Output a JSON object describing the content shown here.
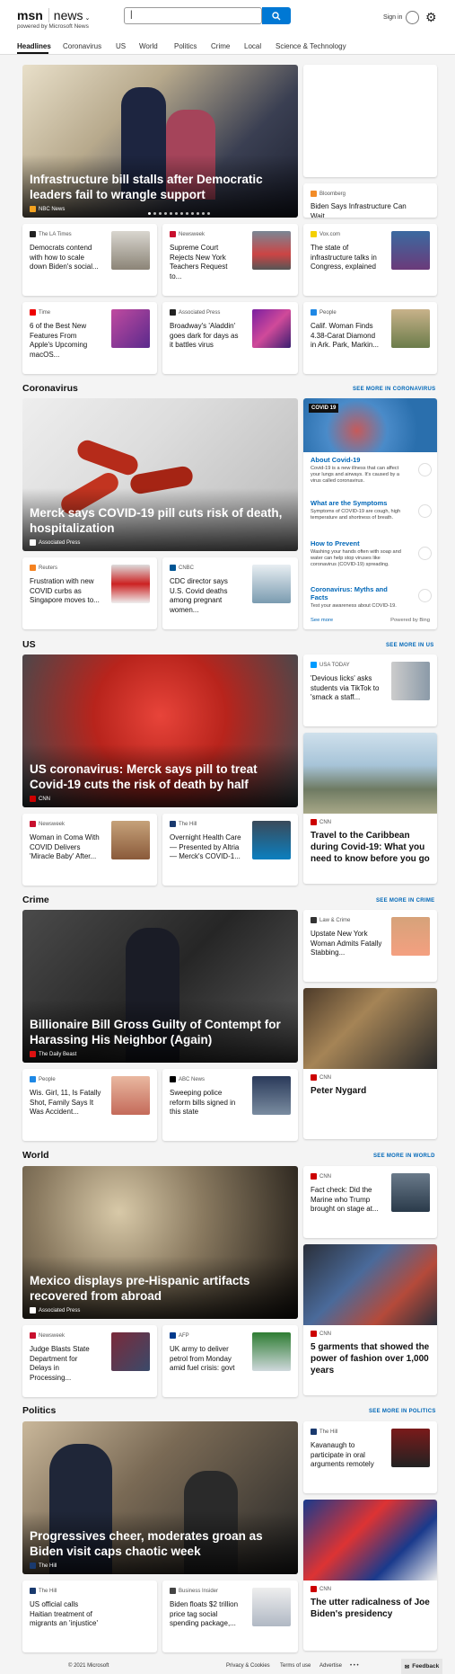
{
  "header": {
    "logo_msn": "msn",
    "logo_news": "news",
    "powered": "powered by Microsoft News",
    "search_value": "|",
    "signin": "Sign in"
  },
  "nav": [
    "Headlines",
    "Coronavirus",
    "US",
    "World",
    "Politics",
    "Crime",
    "Local",
    "Science & Technology"
  ],
  "top": {
    "hero": {
      "title": "Infrastructure bill stalls after Democratic leaders fail to wrangle support",
      "source": "NBC News"
    },
    "side_caption": {
      "source": "Bloomberg",
      "title": "Biden Says Infrastructure Can Wait,..."
    },
    "row1": [
      {
        "source": "The LA Times",
        "title": "Democrats contend with how to scale down Biden's social..."
      },
      {
        "source": "Newsweek",
        "title": "Supreme Court Rejects New York Teachers Request to..."
      },
      {
        "source": "Vox.com",
        "title": "The state of infrastructure talks in Congress, explained"
      }
    ],
    "row2": [
      {
        "source": "Time",
        "title": "6 of the Best New Features From Apple's Upcoming macOS..."
      },
      {
        "source": "Associated Press",
        "title": "Broadway's 'Aladdin' goes dark for days as it battles virus"
      },
      {
        "source": "People",
        "title": "Calif. Woman Finds 4.38-Carat Diamond in Ark. Park, Markin..."
      }
    ]
  },
  "coronavirus": {
    "heading": "Coronavirus",
    "more": "SEE MORE IN CORONAVIRUS",
    "hero": {
      "title": "Merck says COVID-19 pill cuts risk of death, hospitalization",
      "source": "Associated Press"
    },
    "panel": {
      "tag": "COVID 19",
      "items": [
        {
          "h": "About Covid-19",
          "d": "Covid-19 is a new illness that can affect your lungs and airways. It's caused by a virus called coronavirus."
        },
        {
          "h": "What are the Symptoms",
          "d": "Symptoms of COVID-19 are cough, high temperature and shortness of breath."
        },
        {
          "h": "How to Prevent",
          "d": "Washing your hands often with soap and water can help stop viruses like coronavirus (COVID-19) spreading."
        },
        {
          "h": "Coronavirus: Myths and Facts",
          "d": "Test your awareness about COVID-19."
        }
      ],
      "see_more": "See more",
      "powered": "Powered by Bing"
    },
    "row": [
      {
        "source": "Reuters",
        "title": "Frustration with new COVID curbs as Singapore moves to..."
      },
      {
        "source": "CNBC",
        "title": "CDC director says U.S. Covid deaths among pregnant women..."
      }
    ]
  },
  "us": {
    "heading": "US",
    "more": "SEE MORE IN US",
    "hero": {
      "title": "US coronavirus: Merck says pill to treat Covid-19 cuts the risk of death by half",
      "source": "CNN"
    },
    "side": {
      "source": "USA TODAY",
      "title": "'Devious licks' asks students via TikTok to 'smack a staff..."
    },
    "tall": {
      "source": "CNN",
      "title": "Travel to the Caribbean during Covid-19: What you need to know before you go"
    },
    "row": [
      {
        "source": "Newsweek",
        "title": "Woman in Coma With COVID Delivers 'Miracle Baby' After..."
      },
      {
        "source": "The Hill",
        "title": "Overnight Health Care — Presented by Altria — Merck's COVID-1..."
      }
    ]
  },
  "crime": {
    "heading": "Crime",
    "more": "SEE MORE IN CRIME",
    "hero": {
      "title": "Billionaire Bill Gross Guilty of Contempt for Harassing His Neighbor (Again)",
      "source": "The Daily Beast"
    },
    "side": {
      "source": "Law & Crime",
      "title": "Upstate New York Woman Admits Fatally Stabbing..."
    },
    "tall": {
      "source": "CNN",
      "title": "Peter Nygard"
    },
    "row": [
      {
        "source": "People",
        "title": "Wis. Girl, 11, Is Fatally Shot, Family Says It Was Accident..."
      },
      {
        "source": "ABC News",
        "title": "Sweeping police reform bills signed in this state"
      }
    ]
  },
  "world": {
    "heading": "World",
    "more": "SEE MORE IN WORLD",
    "hero": {
      "title": "Mexico displays pre-Hispanic artifacts recovered from abroad",
      "source": "Associated Press"
    },
    "side": {
      "source": "CNN",
      "title": "Fact check: Did the Marine who Trump brought on stage at..."
    },
    "tall": {
      "source": "CNN",
      "title": "5 garments that showed the power of fashion over 1,000 years"
    },
    "row": [
      {
        "source": "Newsweek",
        "title": "Judge Blasts State Department for Delays in Processing..."
      },
      {
        "source": "AFP",
        "title": "UK army to deliver petrol from Monday amid fuel crisis: govt"
      }
    ]
  },
  "politics": {
    "heading": "Politics",
    "more": "SEE MORE IN POLITICS",
    "hero": {
      "title": "Progressives cheer, moderates groan as Biden visit caps chaotic week",
      "source": "The Hill"
    },
    "side": {
      "source": "The Hill",
      "title": "Kavanaugh to participate in oral arguments remotely"
    },
    "tall": {
      "source": "CNN",
      "title": "The utter radicalness of Joe Biden's presidency"
    },
    "row": [
      {
        "source": "The Hill",
        "title": "US official calls Haitian treatment of migrants an 'injustice'"
      },
      {
        "source": "Business Insider",
        "title": "Biden floats $2 trillion price tag social spending package,..."
      }
    ]
  },
  "footer": {
    "copyright": "© 2021 Microsoft",
    "privacy": "Privacy & Cookies",
    "terms": "Terms of use",
    "advertise": "Advertise",
    "dots": "• • •",
    "feedback": "Feedback"
  }
}
